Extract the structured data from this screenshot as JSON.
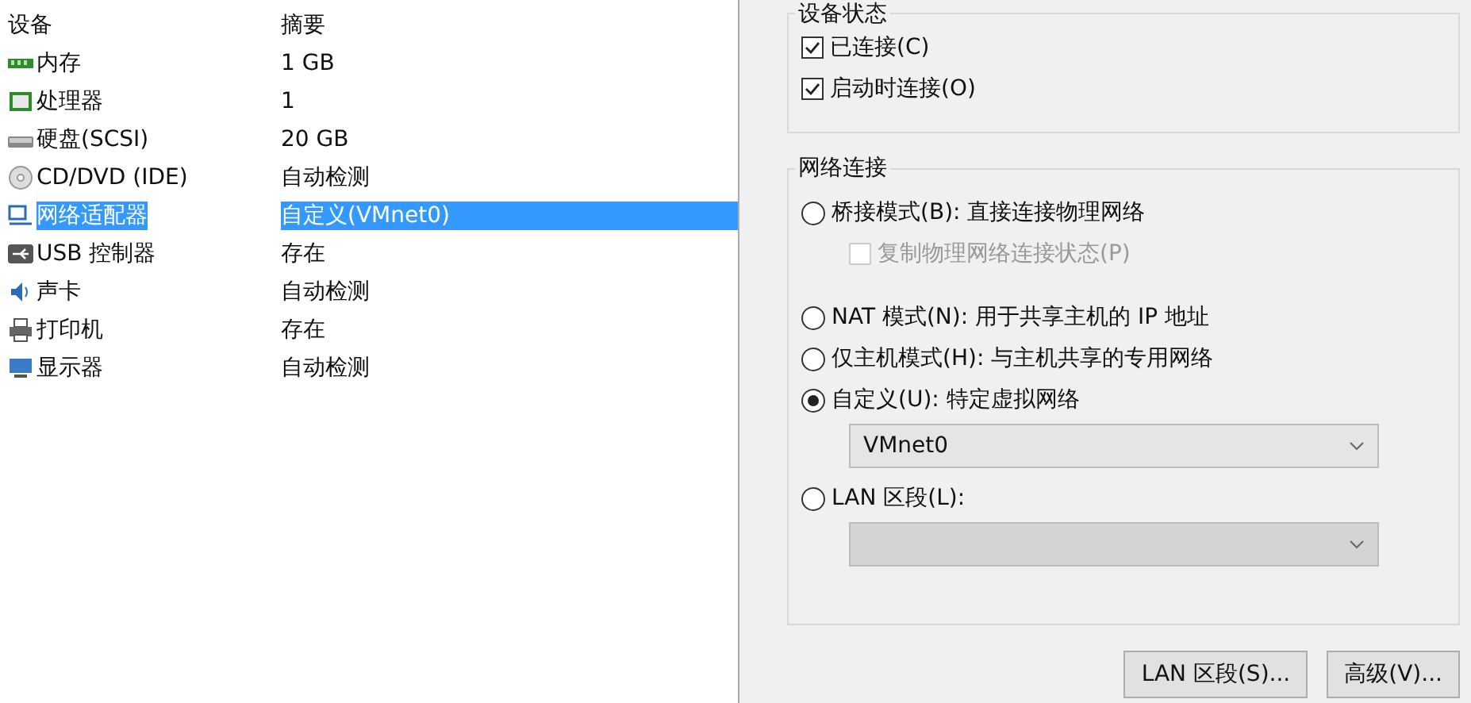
{
  "table": {
    "columns": [
      "设备",
      "摘要"
    ],
    "rows": [
      {
        "kind": "memory",
        "device": "内存",
        "summary": "1 GB",
        "selected": false
      },
      {
        "kind": "cpu",
        "device": "处理器",
        "summary": "1",
        "selected": false
      },
      {
        "kind": "disk",
        "device": "硬盘(SCSI)",
        "summary": "20 GB",
        "selected": false
      },
      {
        "kind": "cd",
        "device": "CD/DVD (IDE)",
        "summary": "自动检测",
        "selected": false
      },
      {
        "kind": "network",
        "device": "网络适配器",
        "summary": "自定义(VMnet0)",
        "selected": true
      },
      {
        "kind": "usb",
        "device": "USB 控制器",
        "summary": "存在",
        "selected": false
      },
      {
        "kind": "sound",
        "device": "声卡",
        "summary": "自动检测",
        "selected": false
      },
      {
        "kind": "printer",
        "device": "打印机",
        "summary": "存在",
        "selected": false
      },
      {
        "kind": "display",
        "device": "显示器",
        "summary": "自动检测",
        "selected": false
      }
    ]
  },
  "device_status": {
    "title": "设备状态",
    "options": [
      {
        "label": "已连接(C)",
        "checked": true
      },
      {
        "label": "启动时连接(O)",
        "checked": true
      }
    ]
  },
  "network_connection": {
    "title": "网络连接",
    "items": [
      {
        "kind": "radio",
        "label": "桥接模式(B): 直接连接物理网络",
        "selected": false
      },
      {
        "kind": "checkbox",
        "label": "复制物理网络连接状态(P)",
        "checked": false,
        "disabled": true
      },
      {
        "kind": "radio",
        "label": "NAT 模式(N): 用于共享主机的 IP 地址",
        "selected": false
      },
      {
        "kind": "radio",
        "label": "仅主机模式(H): 与主机共享的专用网络",
        "selected": false
      },
      {
        "kind": "radio",
        "label": "自定义(U): 特定虚拟网络",
        "selected": true
      },
      {
        "kind": "dropdown",
        "value": "VMnet0",
        "disabled": false
      },
      {
        "kind": "radio",
        "label": "LAN 区段(L):",
        "selected": false
      },
      {
        "kind": "dropdown",
        "value": "",
        "disabled": true
      }
    ]
  },
  "buttons": [
    "LAN 区段(S)...",
    "高级(V)..."
  ]
}
